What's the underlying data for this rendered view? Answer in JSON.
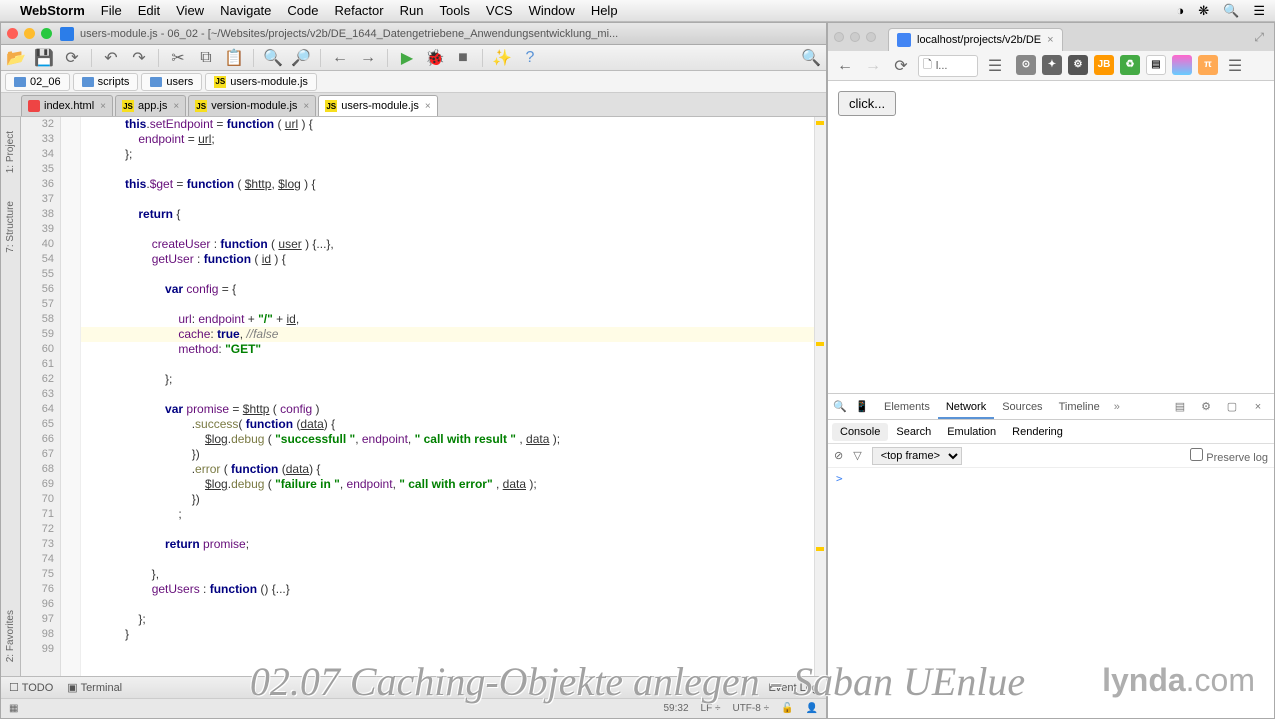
{
  "menubar": {
    "app": "WebStorm",
    "items": [
      "File",
      "Edit",
      "View",
      "Navigate",
      "Code",
      "Refactor",
      "Run",
      "Tools",
      "VCS",
      "Window",
      "Help"
    ]
  },
  "webstorm": {
    "title": "users-module.js - 06_02 - [~/Websites/projects/v2b/DE_1644_Datengetriebene_Anwendungsentwicklung_mi...",
    "breadcrumb": [
      "02_06",
      "scripts",
      "users",
      "users-module.js"
    ],
    "tabs": [
      {
        "label": "index.html",
        "icon": "html"
      },
      {
        "label": "app.js",
        "icon": "js"
      },
      {
        "label": "version-module.js",
        "icon": "js"
      },
      {
        "label": "users-module.js",
        "icon": "js",
        "active": true
      }
    ],
    "line_numbers": [
      32,
      33,
      34,
      35,
      36,
      37,
      38,
      39,
      40,
      54,
      55,
      56,
      57,
      58,
      59,
      60,
      61,
      62,
      63,
      64,
      65,
      66,
      67,
      68,
      69,
      70,
      71,
      72,
      73,
      74,
      75,
      76,
      96,
      97,
      98,
      99
    ],
    "highlighted_line_index": 14,
    "code_lines": [
      {
        "indent": 3,
        "html": "<span class='this'>this</span>.<span class='prop'>setEndpoint</span> = <span class='kw'>function</span> ( <span class='param'>url</span> ) {"
      },
      {
        "indent": 4,
        "html": "<span class='prop'>endpoint</span> = <span class='param'>url</span>;"
      },
      {
        "indent": 3,
        "html": "};"
      },
      {
        "indent": 0,
        "html": ""
      },
      {
        "indent": 3,
        "html": "<span class='this'>this</span>.<span class='prop'>$get</span> = <span class='kw'>function</span> ( <span class='param'>$http</span>, <span class='param'>$log</span> ) {"
      },
      {
        "indent": 0,
        "html": ""
      },
      {
        "indent": 4,
        "html": "<span class='kw'>return</span> {"
      },
      {
        "indent": 0,
        "html": ""
      },
      {
        "indent": 5,
        "html": "<span class='prop'>createUser</span> : <span class='kw'>function</span> ( <span class='param'>user</span> ) {...},"
      },
      {
        "indent": 5,
        "html": "<span class='prop'>getUser</span> : <span class='kw'>function</span> ( <span class='param'>id</span> ) {"
      },
      {
        "indent": 0,
        "html": ""
      },
      {
        "indent": 6,
        "html": "<span class='kw'>var</span> <span class='prop'>config</span> = {"
      },
      {
        "indent": 0,
        "html": ""
      },
      {
        "indent": 7,
        "html": "<span class='prop'>url</span>: <span class='prop'>endpoint</span> + <span class='str'>\"/\"</span> + <span class='param'>id</span>,"
      },
      {
        "indent": 7,
        "html": "<span class='prop'>cache</span>: <span class='bool'>true</span>, <span class='cmt'>//false</span>"
      },
      {
        "indent": 7,
        "html": "<span class='prop'>method</span>: <span class='str'>\"GET\"</span>"
      },
      {
        "indent": 0,
        "html": ""
      },
      {
        "indent": 6,
        "html": "};"
      },
      {
        "indent": 0,
        "html": ""
      },
      {
        "indent": 6,
        "html": "<span class='kw'>var</span> <span class='prop'>promise</span> = <span class='param'>$http</span> ( <span class='prop'>config</span> )"
      },
      {
        "indent": 8,
        "html": ".<span class='fn'>success</span>( <span class='kw'>function</span> (<span class='param'>data</span>) {"
      },
      {
        "indent": 9,
        "html": "<span class='param'>$log</span>.<span class='fn'>debug</span> ( <span class='str'>\"successfull \"</span>, <span class='prop'>endpoint</span>, <span class='str'>\" call with result \"</span> , <span class='param'>data</span> );"
      },
      {
        "indent": 8,
        "html": "})"
      },
      {
        "indent": 8,
        "html": ".<span class='fn'>error</span> ( <span class='kw'>function</span> (<span class='param'>data</span>) {"
      },
      {
        "indent": 9,
        "html": "<span class='param'>$log</span>.<span class='fn'>debug</span> ( <span class='str'>\"failure in \"</span>, <span class='prop'>endpoint</span>, <span class='str'>\" call with error\"</span> , <span class='param'>data</span> );"
      },
      {
        "indent": 8,
        "html": "})"
      },
      {
        "indent": 7,
        "html": ";"
      },
      {
        "indent": 0,
        "html": ""
      },
      {
        "indent": 6,
        "html": "<span class='kw'>return</span> <span class='prop'>promise</span>;"
      },
      {
        "indent": 0,
        "html": ""
      },
      {
        "indent": 5,
        "html": "},"
      },
      {
        "indent": 5,
        "html": "<span class='prop'>getUsers</span> : <span class='kw'>function</span> () {...}"
      },
      {
        "indent": 0,
        "html": ""
      },
      {
        "indent": 4,
        "html": "};"
      },
      {
        "indent": 3,
        "html": "}"
      },
      {
        "indent": 0,
        "html": ""
      }
    ],
    "bottom": {
      "todo": "TODO",
      "terminal": "Terminal",
      "eventlog": "Event Log"
    },
    "status": {
      "pos": "59:32",
      "eol": "LF",
      "enc": "UTF-8"
    }
  },
  "chrome": {
    "tab_title": "localhost/projects/v2b/DE",
    "addr": "l...",
    "button_label": "click...",
    "devtools": {
      "tabs": [
        "Elements",
        "Network",
        "Sources",
        "Timeline"
      ],
      "active_tab": "Network",
      "subtabs": [
        "Console",
        "Search",
        "Emulation",
        "Rendering"
      ],
      "active_subtab": "Console",
      "frame": "<top frame>",
      "preserve": "Preserve log"
    }
  },
  "watermark": "02.07 Caching-Objekte anlegen - Saban UEnlue",
  "brand": "lynda",
  "brand_suffix": ".com"
}
